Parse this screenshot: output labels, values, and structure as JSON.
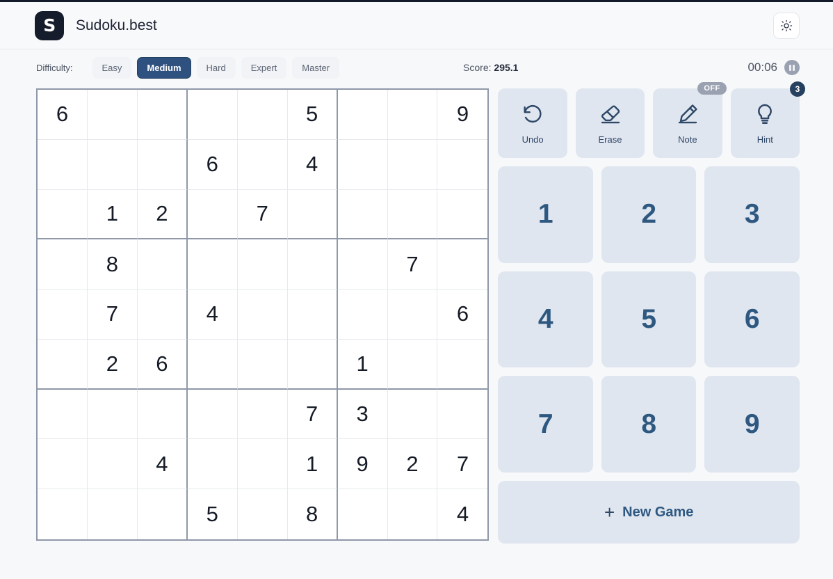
{
  "header": {
    "logo_letter": "S",
    "title": "Sudoku.best",
    "theme_toggle_icon": "sun-icon"
  },
  "toolbar": {
    "difficulty_label": "Difficulty:",
    "difficulties": [
      {
        "label": "Easy",
        "selected": false
      },
      {
        "label": "Medium",
        "selected": true
      },
      {
        "label": "Hard",
        "selected": false
      },
      {
        "label": "Expert",
        "selected": false
      },
      {
        "label": "Master",
        "selected": false
      }
    ],
    "score_label": "Score:",
    "score_value": "295.1",
    "timer": "00:06",
    "pause_icon": "pause-icon"
  },
  "board": {
    "rows": [
      [
        "6",
        "",
        "",
        "",
        "",
        "5",
        "",
        "",
        "9"
      ],
      [
        "",
        "",
        "",
        "6",
        "",
        "4",
        "",
        "",
        ""
      ],
      [
        "",
        "1",
        "2",
        "",
        "7",
        "",
        "",
        "",
        ""
      ],
      [
        "",
        "8",
        "",
        "",
        "",
        "",
        "",
        "7",
        ""
      ],
      [
        "",
        "7",
        "",
        "4",
        "",
        "",
        "",
        "",
        "6"
      ],
      [
        "",
        "2",
        "6",
        "",
        "",
        "",
        "1",
        "",
        ""
      ],
      [
        "",
        "",
        "",
        "",
        "",
        "7",
        "3",
        "",
        ""
      ],
      [
        "",
        "",
        "4",
        "",
        "",
        "1",
        "9",
        "2",
        "7"
      ],
      [
        "",
        "",
        "",
        "5",
        "",
        "8",
        "",
        "",
        "4"
      ]
    ]
  },
  "actions": [
    {
      "label": "Undo",
      "icon": "undo-icon",
      "badge": null,
      "badge_type": null
    },
    {
      "label": "Erase",
      "icon": "eraser-icon",
      "badge": null,
      "badge_type": null
    },
    {
      "label": "Note",
      "icon": "pencil-icon",
      "badge": "OFF",
      "badge_type": "off"
    },
    {
      "label": "Hint",
      "icon": "lightbulb-icon",
      "badge": "3",
      "badge_type": "count"
    }
  ],
  "numpad": [
    "1",
    "2",
    "3",
    "4",
    "5",
    "6",
    "7",
    "8",
    "9"
  ],
  "new_game": {
    "label": "New Game",
    "plus": "+"
  },
  "colors": {
    "page_bg": "#f7f8fa",
    "accent": "#2f5180",
    "number_blue": "#2e5880",
    "panel_bg": "#e0e6f0",
    "grid_thick": "#8f98a8",
    "grid_thin": "#e6e8ec",
    "badge_gray": "#9aa2b1",
    "badge_navy": "#26415f"
  }
}
